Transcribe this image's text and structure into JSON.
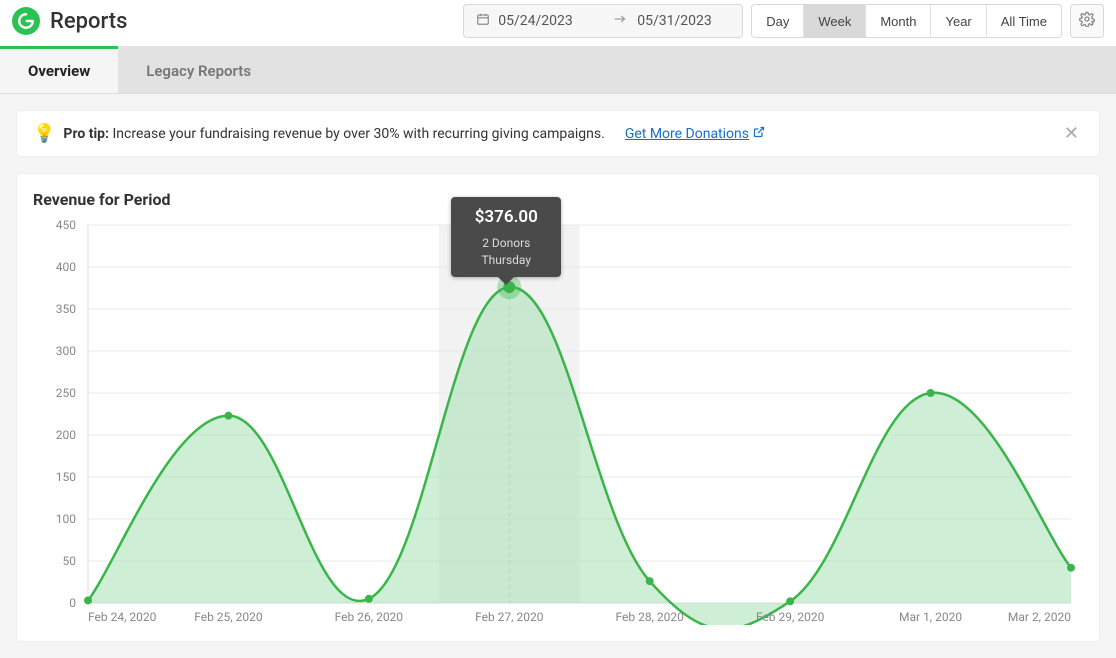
{
  "header": {
    "title": "Reports",
    "date_start": "05/24/2023",
    "date_end": "05/31/2023",
    "range_buttons": [
      "Day",
      "Week",
      "Month",
      "Year",
      "All Time"
    ],
    "range_active": "Week"
  },
  "tabs": [
    {
      "label": "Overview",
      "active": true
    },
    {
      "label": "Legacy Reports",
      "active": false
    }
  ],
  "protip": {
    "prefix": "Pro tip:",
    "body": "Increase your fundraising revenue by over 30% with recurring giving campaigns.",
    "link_label": "Get More Donations"
  },
  "chart": {
    "title": "Revenue for Period",
    "tooltip": {
      "amount": "$376.00",
      "line1": "2 Donors",
      "line2": "Thursday"
    }
  },
  "chart_data": {
    "type": "area",
    "categories": [
      "Feb 24, 2020",
      "Feb 25, 2020",
      "Feb 26, 2020",
      "Feb 27, 2020",
      "Feb 28, 2020",
      "Feb 29, 2020",
      "Mar 1, 2020",
      "Mar 2, 2020"
    ],
    "values": [
      3,
      223,
      5,
      376,
      26,
      2,
      250,
      42
    ],
    "ylabel": "",
    "xlabel": "",
    "ylim": [
      0,
      450
    ],
    "yticks": [
      0,
      50,
      100,
      150,
      200,
      250,
      300,
      350,
      400,
      450
    ],
    "highlight_index": 3,
    "colors": {
      "stroke": "#39b54a",
      "fill": "#a6e0b2"
    }
  }
}
